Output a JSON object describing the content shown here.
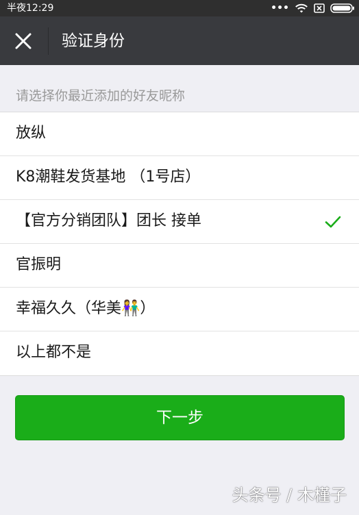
{
  "status_bar": {
    "time": "半夜12:29",
    "icons": [
      "more-dots-icon",
      "wifi-icon",
      "sim-off-icon",
      "battery-icon"
    ]
  },
  "header": {
    "close_icon": "close-icon",
    "title": "验证身份"
  },
  "hint": "请选择你最近添加的好友昵称",
  "options": [
    {
      "label": "放纵",
      "selected": false
    },
    {
      "label": "K8潮鞋发货基地 （1号店）",
      "selected": false
    },
    {
      "label": "【官方分销团队】团长 接单",
      "selected": true
    },
    {
      "label": "官振明",
      "selected": false
    },
    {
      "label": "幸福久久（华美👫）",
      "selected": false
    },
    {
      "label": "以上都不是",
      "selected": false
    }
  ],
  "next_button": {
    "label": "下一步"
  },
  "watermark": "头条号 / 木槿子",
  "colors": {
    "accent": "#1aad19",
    "check": "#1aad19",
    "header_bg": "#393a3e",
    "status_bg": "#2f2f2f",
    "page_bg": "#efeff4"
  }
}
